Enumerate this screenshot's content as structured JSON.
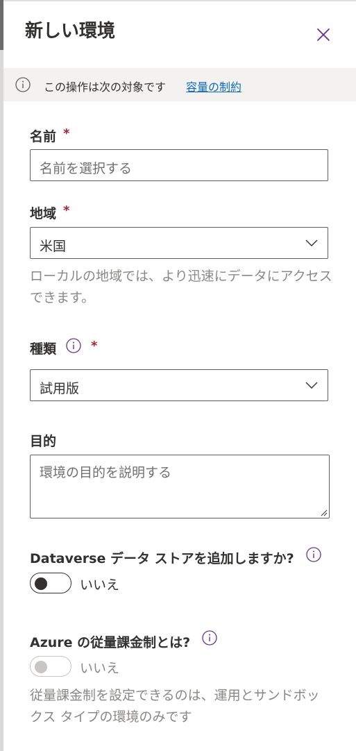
{
  "panel": {
    "title": "新しい環境",
    "close_label": "閉じる"
  },
  "info_bar": {
    "text": "この操作は次の対象です",
    "link": "容量の制約"
  },
  "name": {
    "label": "名前",
    "required": "*",
    "placeholder": "名前を選択する"
  },
  "region": {
    "label": "地域",
    "required": "*",
    "value": "米国",
    "help": "ローカルの地域では、より迅速にデータにアクセスできます。"
  },
  "type": {
    "label": "種類",
    "required": "*",
    "value": "試用版"
  },
  "purpose": {
    "label": "目的",
    "placeholder": "環境の目的を説明する"
  },
  "dataverse": {
    "label": "Dataverse データ ストアを追加しますか?",
    "toggle_label": "いいえ"
  },
  "azure": {
    "label": "Azure の従量課金制とは?",
    "toggle_label": "いいえ",
    "help": "従量課金制を設定できるのは、運用とサンドボックス タイプの環境のみです"
  },
  "colors": {
    "accent": "#0f6cbd",
    "required": "#a4262c",
    "icon_purple": "#6b2d8f",
    "info_bar_bg": "#f3f2f1"
  }
}
